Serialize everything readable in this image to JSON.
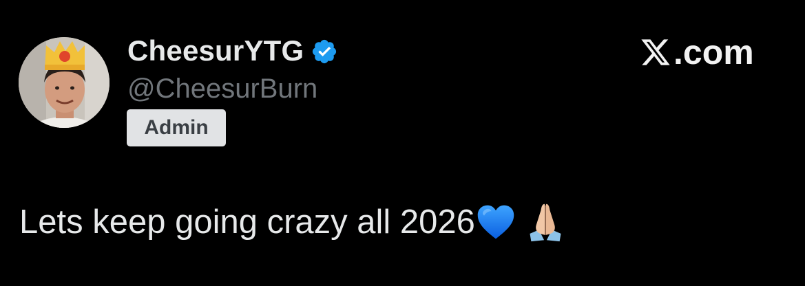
{
  "tweet": {
    "display_name": "CheesurYTG",
    "handle": "@CheesurBurn",
    "role_badge": "Admin",
    "verified": true,
    "text": "Lets keep going crazy all 2026",
    "emojis": [
      "blue-heart-icon",
      "folded-hands-icon"
    ]
  },
  "brand": {
    "label": ".com",
    "logo": "x-logo-icon"
  },
  "colors": {
    "background": "#000000",
    "primary_text": "#e7e9ea",
    "secondary_text": "#71767b",
    "verified_blue": "#1d9bf0",
    "badge_bg": "#e1e3e5"
  }
}
